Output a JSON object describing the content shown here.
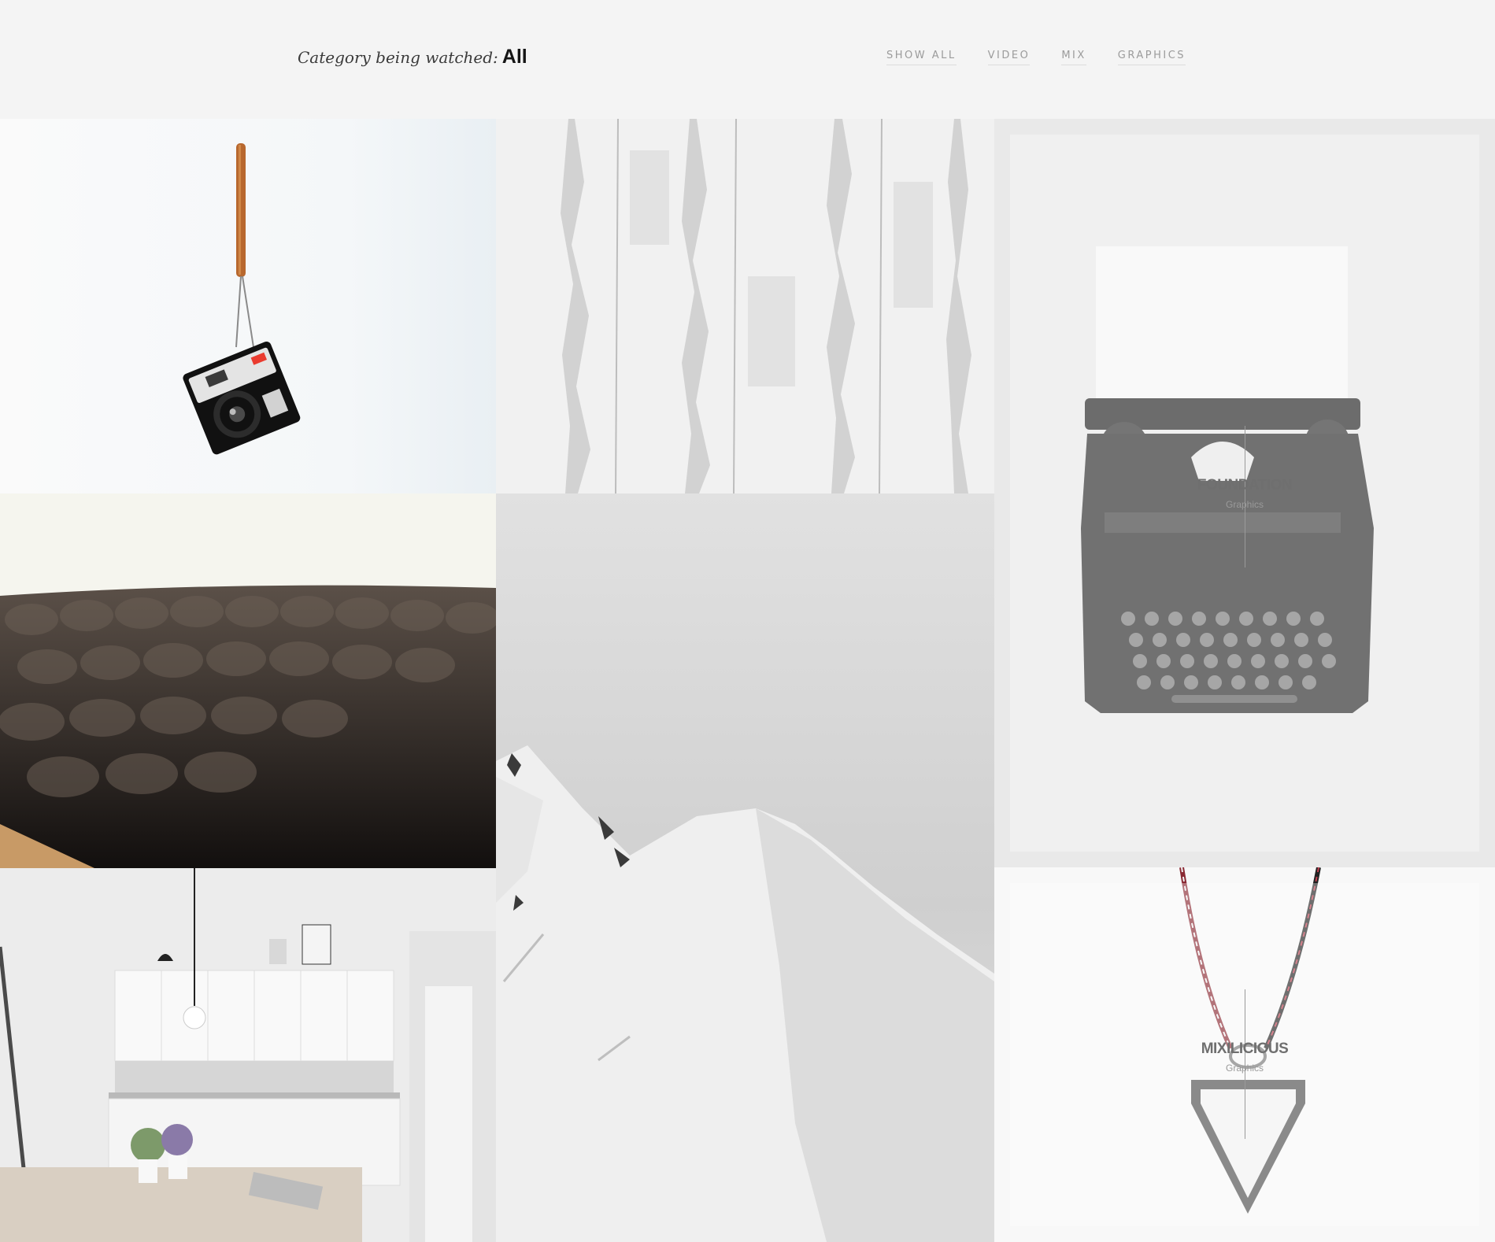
{
  "header": {
    "category_label": "Category being watched:",
    "category_value": "All"
  },
  "filters": [
    "SHOW ALL",
    "VIDEO",
    "MIX",
    "GRAPHICS"
  ],
  "portfolio": [
    {
      "name": "camera-photo"
    },
    {
      "name": "peeling-wood-texture"
    },
    {
      "name": "typewriter",
      "title": "FOUNDATION",
      "subtitle": "Graphics"
    },
    {
      "name": "leather-sofa"
    },
    {
      "name": "snowy-mountain"
    },
    {
      "name": "white-kitchen"
    },
    {
      "name": "necklace",
      "title": "MIXILICIOUS",
      "subtitle": "Graphics"
    }
  ],
  "colors": {
    "background": "#f4f4f4",
    "nav_text": "#9b9b9b",
    "category_value": "#151515"
  }
}
